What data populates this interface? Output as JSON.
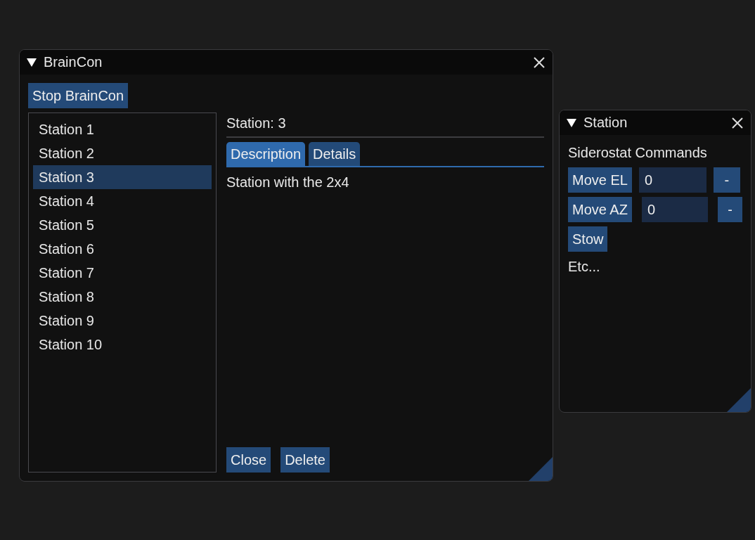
{
  "braincon_window": {
    "title": "BrainCon",
    "stop_button": "Stop BrainCon",
    "stations": [
      {
        "label": "Station 1",
        "selected": false
      },
      {
        "label": "Station 2",
        "selected": false
      },
      {
        "label": "Station 3",
        "selected": true
      },
      {
        "label": "Station 4",
        "selected": false
      },
      {
        "label": "Station 5",
        "selected": false
      },
      {
        "label": "Station 6",
        "selected": false
      },
      {
        "label": "Station 7",
        "selected": false
      },
      {
        "label": "Station 8",
        "selected": false
      },
      {
        "label": "Station 9",
        "selected": false
      },
      {
        "label": "Station 10",
        "selected": false
      }
    ],
    "detail_heading": "Station: 3",
    "tabs": [
      {
        "label": "Description",
        "selected": true
      },
      {
        "label": "Details",
        "selected": false
      }
    ],
    "description": "Station with the 2x4",
    "buttons": [
      "Close",
      "Delete"
    ]
  },
  "station_window": {
    "title": "Station",
    "heading": "Siderostat Commands",
    "commands": [
      {
        "button": "Move EL",
        "value": "0",
        "step": "-"
      },
      {
        "button": "Move AZ",
        "value": "0",
        "step": "-"
      }
    ],
    "stow_button": "Stow",
    "footer": "Etc..."
  }
}
